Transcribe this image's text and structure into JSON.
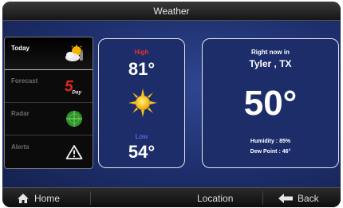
{
  "title": "Weather",
  "sidebar": {
    "items": [
      {
        "label": "Today",
        "icon": "partly-cloudy-icon"
      },
      {
        "label": "Forecast",
        "icon": "five-day-icon"
      },
      {
        "label": "Radar",
        "icon": "radar-icon"
      },
      {
        "label": "Alerts",
        "icon": "alert-icon"
      }
    ],
    "five_day_number": "5",
    "five_day_word": "Day"
  },
  "forecast": {
    "high_label": "High",
    "high_value": "81°",
    "low_label": "Low",
    "low_value": "54°",
    "icon": "sun-icon"
  },
  "current": {
    "label": "Right now in",
    "city": "Tyler , TX",
    "temperature": "50°",
    "humidity": "Humidity : 85%",
    "dew_point": "Dew Point : 46°"
  },
  "bottom": {
    "home_label": "Home",
    "location_label": "Location",
    "back_label": "Back"
  },
  "colors": {
    "high": "#e23030",
    "low": "#4d6bd6",
    "background": "#1d2e6b"
  }
}
